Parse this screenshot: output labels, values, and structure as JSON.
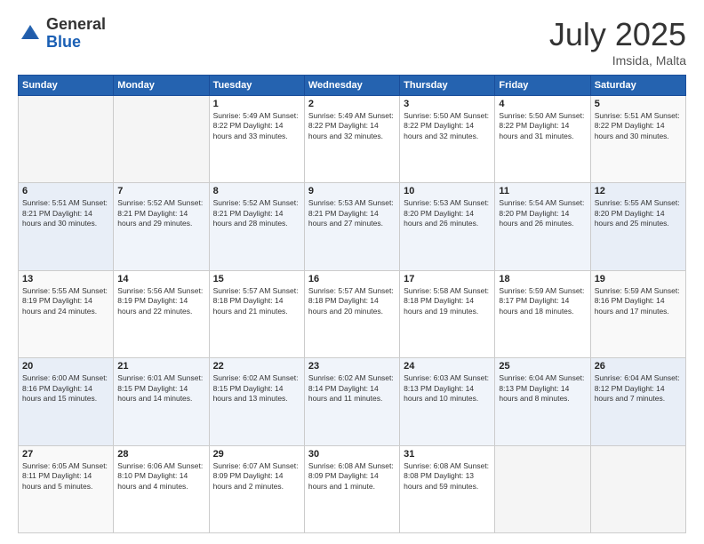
{
  "header": {
    "logo": {
      "general": "General",
      "blue": "Blue"
    },
    "title": "July 2025",
    "subtitle": "Imsida, Malta"
  },
  "days": [
    "Sunday",
    "Monday",
    "Tuesday",
    "Wednesday",
    "Thursday",
    "Friday",
    "Saturday"
  ],
  "weeks": [
    [
      {
        "day": "",
        "content": ""
      },
      {
        "day": "",
        "content": ""
      },
      {
        "day": "1",
        "content": "Sunrise: 5:49 AM\nSunset: 8:22 PM\nDaylight: 14 hours\nand 33 minutes."
      },
      {
        "day": "2",
        "content": "Sunrise: 5:49 AM\nSunset: 8:22 PM\nDaylight: 14 hours\nand 32 minutes."
      },
      {
        "day": "3",
        "content": "Sunrise: 5:50 AM\nSunset: 8:22 PM\nDaylight: 14 hours\nand 32 minutes."
      },
      {
        "day": "4",
        "content": "Sunrise: 5:50 AM\nSunset: 8:22 PM\nDaylight: 14 hours\nand 31 minutes."
      },
      {
        "day": "5",
        "content": "Sunrise: 5:51 AM\nSunset: 8:22 PM\nDaylight: 14 hours\nand 30 minutes."
      }
    ],
    [
      {
        "day": "6",
        "content": "Sunrise: 5:51 AM\nSunset: 8:21 PM\nDaylight: 14 hours\nand 30 minutes."
      },
      {
        "day": "7",
        "content": "Sunrise: 5:52 AM\nSunset: 8:21 PM\nDaylight: 14 hours\nand 29 minutes."
      },
      {
        "day": "8",
        "content": "Sunrise: 5:52 AM\nSunset: 8:21 PM\nDaylight: 14 hours\nand 28 minutes."
      },
      {
        "day": "9",
        "content": "Sunrise: 5:53 AM\nSunset: 8:21 PM\nDaylight: 14 hours\nand 27 minutes."
      },
      {
        "day": "10",
        "content": "Sunrise: 5:53 AM\nSunset: 8:20 PM\nDaylight: 14 hours\nand 26 minutes."
      },
      {
        "day": "11",
        "content": "Sunrise: 5:54 AM\nSunset: 8:20 PM\nDaylight: 14 hours\nand 26 minutes."
      },
      {
        "day": "12",
        "content": "Sunrise: 5:55 AM\nSunset: 8:20 PM\nDaylight: 14 hours\nand 25 minutes."
      }
    ],
    [
      {
        "day": "13",
        "content": "Sunrise: 5:55 AM\nSunset: 8:19 PM\nDaylight: 14 hours\nand 24 minutes."
      },
      {
        "day": "14",
        "content": "Sunrise: 5:56 AM\nSunset: 8:19 PM\nDaylight: 14 hours\nand 22 minutes."
      },
      {
        "day": "15",
        "content": "Sunrise: 5:57 AM\nSunset: 8:18 PM\nDaylight: 14 hours\nand 21 minutes."
      },
      {
        "day": "16",
        "content": "Sunrise: 5:57 AM\nSunset: 8:18 PM\nDaylight: 14 hours\nand 20 minutes."
      },
      {
        "day": "17",
        "content": "Sunrise: 5:58 AM\nSunset: 8:18 PM\nDaylight: 14 hours\nand 19 minutes."
      },
      {
        "day": "18",
        "content": "Sunrise: 5:59 AM\nSunset: 8:17 PM\nDaylight: 14 hours\nand 18 minutes."
      },
      {
        "day": "19",
        "content": "Sunrise: 5:59 AM\nSunset: 8:16 PM\nDaylight: 14 hours\nand 17 minutes."
      }
    ],
    [
      {
        "day": "20",
        "content": "Sunrise: 6:00 AM\nSunset: 8:16 PM\nDaylight: 14 hours\nand 15 minutes."
      },
      {
        "day": "21",
        "content": "Sunrise: 6:01 AM\nSunset: 8:15 PM\nDaylight: 14 hours\nand 14 minutes."
      },
      {
        "day": "22",
        "content": "Sunrise: 6:02 AM\nSunset: 8:15 PM\nDaylight: 14 hours\nand 13 minutes."
      },
      {
        "day": "23",
        "content": "Sunrise: 6:02 AM\nSunset: 8:14 PM\nDaylight: 14 hours\nand 11 minutes."
      },
      {
        "day": "24",
        "content": "Sunrise: 6:03 AM\nSunset: 8:13 PM\nDaylight: 14 hours\nand 10 minutes."
      },
      {
        "day": "25",
        "content": "Sunrise: 6:04 AM\nSunset: 8:13 PM\nDaylight: 14 hours\nand 8 minutes."
      },
      {
        "day": "26",
        "content": "Sunrise: 6:04 AM\nSunset: 8:12 PM\nDaylight: 14 hours\nand 7 minutes."
      }
    ],
    [
      {
        "day": "27",
        "content": "Sunrise: 6:05 AM\nSunset: 8:11 PM\nDaylight: 14 hours\nand 5 minutes."
      },
      {
        "day": "28",
        "content": "Sunrise: 6:06 AM\nSunset: 8:10 PM\nDaylight: 14 hours\nand 4 minutes."
      },
      {
        "day": "29",
        "content": "Sunrise: 6:07 AM\nSunset: 8:09 PM\nDaylight: 14 hours\nand 2 minutes."
      },
      {
        "day": "30",
        "content": "Sunrise: 6:08 AM\nSunset: 8:09 PM\nDaylight: 14 hours\nand 1 minute."
      },
      {
        "day": "31",
        "content": "Sunrise: 6:08 AM\nSunset: 8:08 PM\nDaylight: 13 hours\nand 59 minutes."
      },
      {
        "day": "",
        "content": ""
      },
      {
        "day": "",
        "content": ""
      }
    ]
  ]
}
